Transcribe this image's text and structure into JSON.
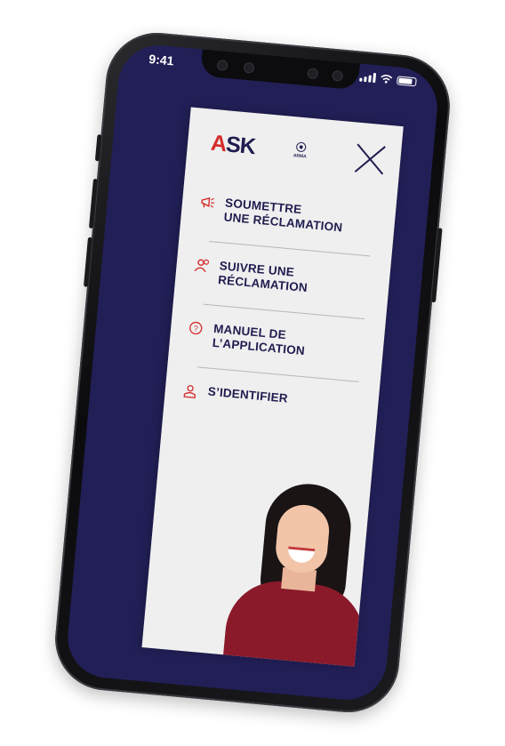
{
  "status_bar": {
    "time": "9:41",
    "icons": [
      "signal-icon",
      "wifi-icon",
      "battery-icon"
    ]
  },
  "header": {
    "logo_text_accent": "A",
    "logo_text_rest": "SK",
    "partner_logo_text": "ARMA",
    "close_icon": "close-icon"
  },
  "menu": {
    "items": [
      {
        "icon": "megaphone-icon",
        "line1": "SOUMETTRE",
        "line2": "UNE RÉCLAMATION"
      },
      {
        "icon": "users-icon",
        "line1": "SUIVRE UNE RÉCLAMATION"
      },
      {
        "icon": "help-circle-icon",
        "line1": "MANUEL DE L’APPLICATION"
      },
      {
        "icon": "user-icon",
        "line1": "S’IDENTIFIER"
      }
    ]
  },
  "colors": {
    "navy": "#1f1d4f",
    "accent_red": "#d52b2b",
    "screen_bg": "#221f57",
    "panel_bg": "#efefef"
  }
}
